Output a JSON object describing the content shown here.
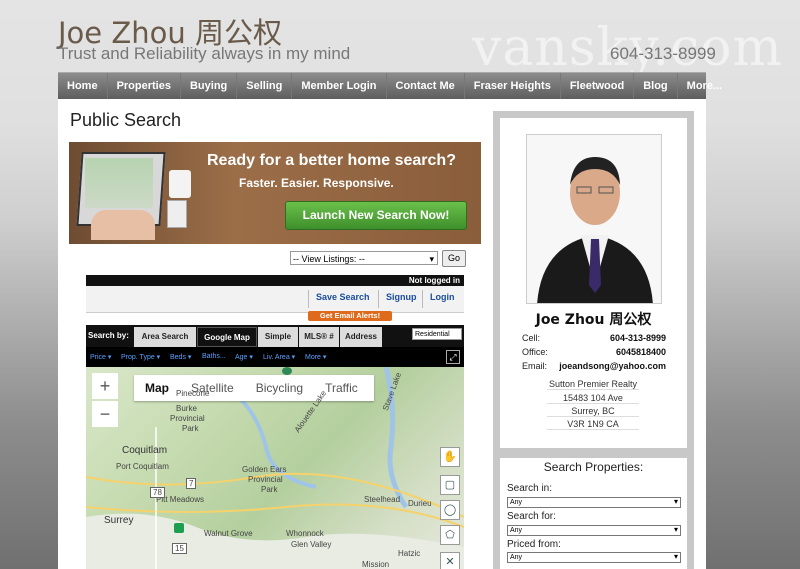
{
  "header": {
    "title": "Joe Zhou 周公权",
    "tagline": "Trust and Reliability always in my mind",
    "phone": "604-313-8999",
    "watermark": "vansky.com"
  },
  "nav": {
    "items": [
      "Home",
      "Properties",
      "Buying",
      "Selling",
      "Member Login",
      "Contact Me",
      "Fraser Heights",
      "Fleetwood",
      "Blog",
      "More..."
    ]
  },
  "main": {
    "page_title": "Public Search",
    "banner": {
      "headline": "Ready for a better home search?",
      "subline": "Faster. Easier. Responsive.",
      "cta": "Launch New Search Now!"
    },
    "listing_select": "-- View Listings: --",
    "go_label": "Go"
  },
  "widget": {
    "status": "Not logged in",
    "toolbar": {
      "save_search": "Save Search",
      "signup": "Signup",
      "login": "Login"
    },
    "email_alerts": "Get Email Alerts!",
    "search_by_label": "Search by:",
    "tabs": [
      "Area Search",
      "Google Map",
      "Simple",
      "MLS® #",
      "Address"
    ],
    "active_tab": "Google Map",
    "property_type": "Residential",
    "filters": [
      "Price ▾",
      "Prop. Type ▾",
      "Beds ▾",
      "Baths...",
      "Age ▾",
      "Liv. Area ▾",
      "More ▾"
    ],
    "map": {
      "map_types": [
        "Map",
        "Satellite",
        "Bicycling",
        "Traffic"
      ],
      "active_map_type": "Map",
      "labels": {
        "coquitlam": "Coquitlam",
        "port_coquitlam": "Port Coquitlam",
        "pitt_meadows": "Pitt Meadows",
        "surrey": "Surrey",
        "golden_ears": "Golden Ears",
        "golden_ears_2": "Provincial",
        "golden_ears_3": "Park",
        "pinecone": "Pinecone",
        "burke": "Burke",
        "provincial": "Provincial",
        "park": "Park",
        "alouette": "Alouette Lake",
        "stave": "Stave Lake",
        "steelhead": "Steelhead",
        "durieu": "Durieu",
        "whonnock": "Whonnock",
        "walnut_grove": "Walnut Grove",
        "glen_valley": "Glen Valley",
        "hatzic": "Hatzic",
        "mission": "Mission",
        "hwy_78": "78",
        "hwy_7": "7",
        "hwy_15": "15"
      }
    }
  },
  "agent": {
    "name": "Joe Zhou 周公权",
    "cell_label": "Cell:",
    "cell": "604-313-8999",
    "office_label": "Office:",
    "office": "6045818400",
    "email_label": "Email:",
    "email": "joeandsong@yahoo.com",
    "address": [
      "Sutton Premier Realty",
      "15483 104 Ave",
      "Surrey, BC",
      "V3R 1N9 CA"
    ]
  },
  "search_properties": {
    "title": "Search Properties:",
    "fields": [
      {
        "label": "Search in:",
        "value": "Any"
      },
      {
        "label": "Search for:",
        "value": "Any"
      },
      {
        "label": "Priced from:",
        "value": "Any"
      }
    ]
  },
  "icons": {
    "hand": "hand-tool-icon",
    "square": "rectangle-draw-icon",
    "circle": "circle-draw-icon",
    "polygon": "polygon-draw-icon",
    "clear": "clear-shapes-icon",
    "expand": "expand-icon"
  }
}
